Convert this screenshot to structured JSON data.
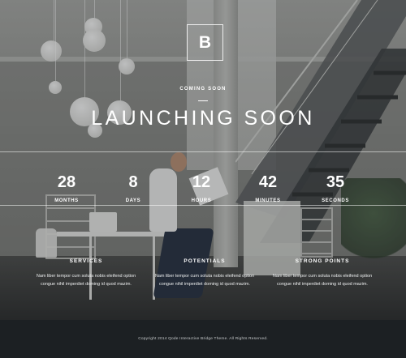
{
  "logo": {
    "letter": "B"
  },
  "hero": {
    "kicker": "COMING SOON",
    "title": "LAUNCHING SOON"
  },
  "countdown": [
    {
      "value": "28",
      "label": "MONTHS"
    },
    {
      "value": "8",
      "label": "DAYS"
    },
    {
      "value": "12",
      "label": "HOURS"
    },
    {
      "value": "42",
      "label": "MINUTES"
    },
    {
      "value": "35",
      "label": "SECONDS"
    }
  ],
  "features": [
    {
      "title": "SERVICES",
      "line1": "Nam liber tempor cum soluta nobis eleifend option",
      "line2": "congue nihil imperdiet doming id quod mazim."
    },
    {
      "title": "POTENTIALS",
      "line1": "Nam liber tempor cum soluta nobis eleifend option",
      "line2": "congue nihil imperdiet doming id quod mazim."
    },
    {
      "title": "STRONG POINTS",
      "line1": "Nam liber tempor cum soluta nobis eleifend option",
      "line2": "congue nihil imperdiet doming id quod mazim."
    }
  ],
  "footer": {
    "copyright": "Copyright 2014 Qode Interactive Bridge Theme. All Rights Reserved."
  }
}
